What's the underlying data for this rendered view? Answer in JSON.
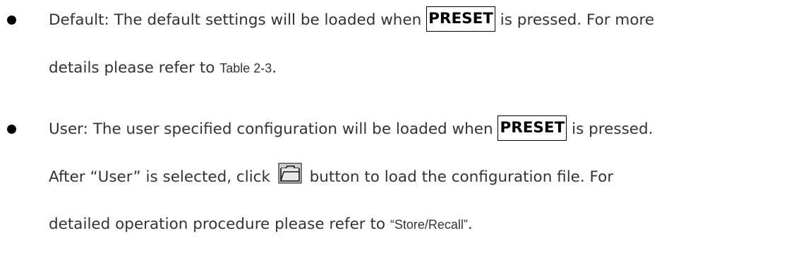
{
  "items": [
    {
      "label": "Default",
      "line1_a": "Default: The default settings will be loaded when ",
      "key": "PRESET",
      "line1_b": " is pressed. For more",
      "line2_a": "details please refer to ",
      "line2_ref": "Table 2-3",
      "line2_b": "."
    },
    {
      "label": "User",
      "line1_a": "User: The user specified configuration will be loaded when ",
      "key": "PRESET",
      "line1_b": " is pressed.",
      "line2_a": "After “User” is selected, click ",
      "button_icon": "folder-open-icon",
      "line2_b": " button to load the configuration file. For",
      "line3_a": "detailed operation procedure please refer to ",
      "line3_ref": "“Store/Recall”",
      "line3_b": "."
    }
  ]
}
